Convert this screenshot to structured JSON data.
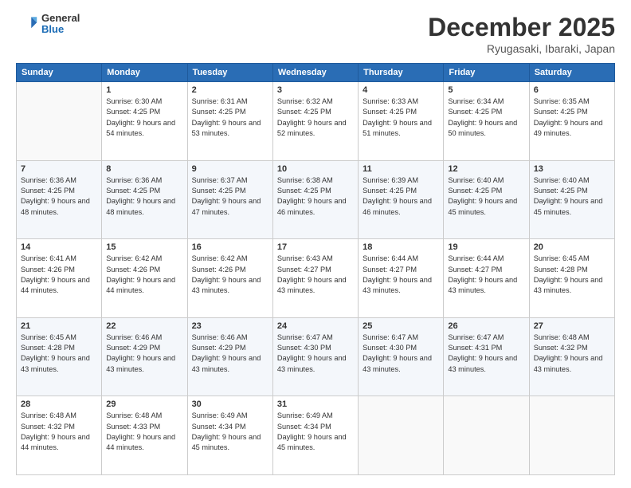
{
  "header": {
    "logo_general": "General",
    "logo_blue": "Blue",
    "month_title": "December 2025",
    "location": "Ryugasaki, Ibaraki, Japan"
  },
  "days_of_week": [
    "Sunday",
    "Monday",
    "Tuesday",
    "Wednesday",
    "Thursday",
    "Friday",
    "Saturday"
  ],
  "weeks": [
    [
      {
        "day": "",
        "detail": ""
      },
      {
        "day": "1",
        "detail": "Sunrise: 6:30 AM\nSunset: 4:25 PM\nDaylight: 9 hours\nand 54 minutes."
      },
      {
        "day": "2",
        "detail": "Sunrise: 6:31 AM\nSunset: 4:25 PM\nDaylight: 9 hours\nand 53 minutes."
      },
      {
        "day": "3",
        "detail": "Sunrise: 6:32 AM\nSunset: 4:25 PM\nDaylight: 9 hours\nand 52 minutes."
      },
      {
        "day": "4",
        "detail": "Sunrise: 6:33 AM\nSunset: 4:25 PM\nDaylight: 9 hours\nand 51 minutes."
      },
      {
        "day": "5",
        "detail": "Sunrise: 6:34 AM\nSunset: 4:25 PM\nDaylight: 9 hours\nand 50 minutes."
      },
      {
        "day": "6",
        "detail": "Sunrise: 6:35 AM\nSunset: 4:25 PM\nDaylight: 9 hours\nand 49 minutes."
      }
    ],
    [
      {
        "day": "7",
        "detail": "Sunrise: 6:36 AM\nSunset: 4:25 PM\nDaylight: 9 hours\nand 48 minutes."
      },
      {
        "day": "8",
        "detail": "Sunrise: 6:36 AM\nSunset: 4:25 PM\nDaylight: 9 hours\nand 48 minutes."
      },
      {
        "day": "9",
        "detail": "Sunrise: 6:37 AM\nSunset: 4:25 PM\nDaylight: 9 hours\nand 47 minutes."
      },
      {
        "day": "10",
        "detail": "Sunrise: 6:38 AM\nSunset: 4:25 PM\nDaylight: 9 hours\nand 46 minutes."
      },
      {
        "day": "11",
        "detail": "Sunrise: 6:39 AM\nSunset: 4:25 PM\nDaylight: 9 hours\nand 46 minutes."
      },
      {
        "day": "12",
        "detail": "Sunrise: 6:40 AM\nSunset: 4:25 PM\nDaylight: 9 hours\nand 45 minutes."
      },
      {
        "day": "13",
        "detail": "Sunrise: 6:40 AM\nSunset: 4:25 PM\nDaylight: 9 hours\nand 45 minutes."
      }
    ],
    [
      {
        "day": "14",
        "detail": "Sunrise: 6:41 AM\nSunset: 4:26 PM\nDaylight: 9 hours\nand 44 minutes."
      },
      {
        "day": "15",
        "detail": "Sunrise: 6:42 AM\nSunset: 4:26 PM\nDaylight: 9 hours\nand 44 minutes."
      },
      {
        "day": "16",
        "detail": "Sunrise: 6:42 AM\nSunset: 4:26 PM\nDaylight: 9 hours\nand 43 minutes."
      },
      {
        "day": "17",
        "detail": "Sunrise: 6:43 AM\nSunset: 4:27 PM\nDaylight: 9 hours\nand 43 minutes."
      },
      {
        "day": "18",
        "detail": "Sunrise: 6:44 AM\nSunset: 4:27 PM\nDaylight: 9 hours\nand 43 minutes."
      },
      {
        "day": "19",
        "detail": "Sunrise: 6:44 AM\nSunset: 4:27 PM\nDaylight: 9 hours\nand 43 minutes."
      },
      {
        "day": "20",
        "detail": "Sunrise: 6:45 AM\nSunset: 4:28 PM\nDaylight: 9 hours\nand 43 minutes."
      }
    ],
    [
      {
        "day": "21",
        "detail": "Sunrise: 6:45 AM\nSunset: 4:28 PM\nDaylight: 9 hours\nand 43 minutes."
      },
      {
        "day": "22",
        "detail": "Sunrise: 6:46 AM\nSunset: 4:29 PM\nDaylight: 9 hours\nand 43 minutes."
      },
      {
        "day": "23",
        "detail": "Sunrise: 6:46 AM\nSunset: 4:29 PM\nDaylight: 9 hours\nand 43 minutes."
      },
      {
        "day": "24",
        "detail": "Sunrise: 6:47 AM\nSunset: 4:30 PM\nDaylight: 9 hours\nand 43 minutes."
      },
      {
        "day": "25",
        "detail": "Sunrise: 6:47 AM\nSunset: 4:30 PM\nDaylight: 9 hours\nand 43 minutes."
      },
      {
        "day": "26",
        "detail": "Sunrise: 6:47 AM\nSunset: 4:31 PM\nDaylight: 9 hours\nand 43 minutes."
      },
      {
        "day": "27",
        "detail": "Sunrise: 6:48 AM\nSunset: 4:32 PM\nDaylight: 9 hours\nand 43 minutes."
      }
    ],
    [
      {
        "day": "28",
        "detail": "Sunrise: 6:48 AM\nSunset: 4:32 PM\nDaylight: 9 hours\nand 44 minutes."
      },
      {
        "day": "29",
        "detail": "Sunrise: 6:48 AM\nSunset: 4:33 PM\nDaylight: 9 hours\nand 44 minutes."
      },
      {
        "day": "30",
        "detail": "Sunrise: 6:49 AM\nSunset: 4:34 PM\nDaylight: 9 hours\nand 45 minutes."
      },
      {
        "day": "31",
        "detail": "Sunrise: 6:49 AM\nSunset: 4:34 PM\nDaylight: 9 hours\nand 45 minutes."
      },
      {
        "day": "",
        "detail": ""
      },
      {
        "day": "",
        "detail": ""
      },
      {
        "day": "",
        "detail": ""
      }
    ]
  ]
}
